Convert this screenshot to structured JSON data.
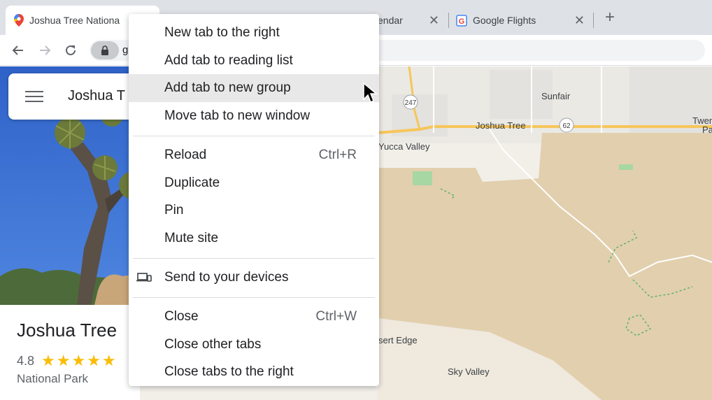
{
  "tabs": [
    {
      "title": "Joshua Tree Nationa",
      "active": true,
      "icon": "google-maps-pin-icon"
    },
    {
      "title": "endar",
      "active": false,
      "icon": "google-calendar-icon"
    },
    {
      "title": "Google Flights",
      "active": false,
      "icon": "google-icon"
    }
  ],
  "toolbar": {
    "url_fragment": "g"
  },
  "search": {
    "query": "Joshua T"
  },
  "place": {
    "title": "Joshua Tree",
    "rating": "4.8",
    "type": "National Park",
    "stars": "★★★★★"
  },
  "map_labels": {
    "sunfair": "Sunfair",
    "joshua_tree": "Joshua Tree",
    "yucca_valley": "Yucca Valley",
    "twen": "Twen",
    "pa": "Pa",
    "desert_edge": "sert Edge",
    "sky_valley": "Sky Valley",
    "route_247": "247",
    "route_62": "62"
  },
  "context_menu": {
    "items": [
      {
        "label": "New tab to the right",
        "shortcut": ""
      },
      {
        "label": "Add tab to reading list",
        "shortcut": ""
      },
      {
        "label": "Add tab to new group",
        "shortcut": ""
      },
      {
        "label": "Move tab to new window",
        "shortcut": ""
      },
      {
        "label": "Reload",
        "shortcut": "Ctrl+R"
      },
      {
        "label": "Duplicate",
        "shortcut": ""
      },
      {
        "label": "Pin",
        "shortcut": ""
      },
      {
        "label": "Mute site",
        "shortcut": ""
      },
      {
        "label": "Send to your devices",
        "shortcut": "",
        "icon": "devices-icon"
      },
      {
        "label": "Close",
        "shortcut": "Ctrl+W"
      },
      {
        "label": "Close other tabs",
        "shortcut": ""
      },
      {
        "label": "Close tabs to the right",
        "shortcut": ""
      }
    ],
    "hovered_index": 2
  },
  "colors": {
    "star": "#fbbc04",
    "menu_hover": "#e8e8e8",
    "map_sand": "#e9e3d4",
    "map_tan": "#e2cfad",
    "road": "#f6c65b"
  }
}
